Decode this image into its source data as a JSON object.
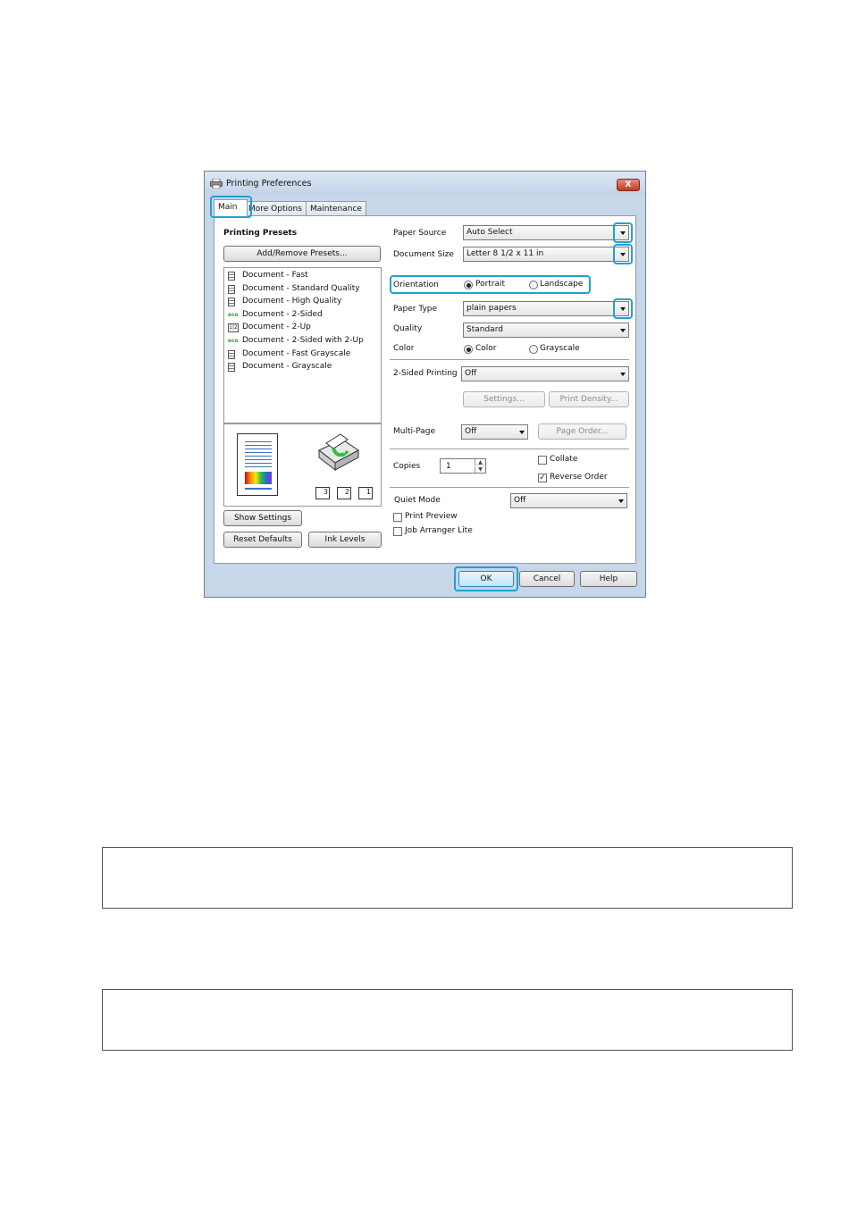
{
  "window": {
    "title": "Printing Preferences",
    "close_label": "X"
  },
  "tabs": [
    {
      "label": "Main"
    },
    {
      "label": "More Options"
    },
    {
      "label": "Maintenance"
    }
  ],
  "presets": {
    "heading": "Printing Presets",
    "add_remove_label": "Add/Remove Presets...",
    "items": [
      {
        "label": "Document - Fast",
        "icon": "document-icon"
      },
      {
        "label": "Document - Standard Quality",
        "icon": "document-icon"
      },
      {
        "label": "Document - High Quality",
        "icon": "document-icon"
      },
      {
        "label": "Document - 2-Sided",
        "icon": "eco-icon",
        "icon_text": "eco"
      },
      {
        "label": "Document - 2-Up",
        "icon": "two-up-icon",
        "icon_text": "1|2"
      },
      {
        "label": "Document - 2-Sided with 2-Up",
        "icon": "eco-icon",
        "icon_text": "eco"
      },
      {
        "label": "Document - Fast Grayscale",
        "icon": "document-icon"
      },
      {
        "label": "Document - Grayscale",
        "icon": "document-icon"
      }
    ]
  },
  "preview": {
    "page_numbers": [
      "3",
      "2",
      "1"
    ]
  },
  "left_buttons": {
    "show_settings": "Show Settings",
    "reset_defaults": "Reset Defaults",
    "ink_levels": "Ink Levels"
  },
  "settings": {
    "paper_source_label": "Paper Source",
    "paper_source_value": "Auto Select",
    "document_size_label": "Document Size",
    "document_size_value": "Letter 8 1/2 x 11 in",
    "orientation_label": "Orientation",
    "portrait_label": "Portrait",
    "landscape_label": "Landscape",
    "paper_type_label": "Paper Type",
    "paper_type_value": "plain papers",
    "quality_label": "Quality",
    "quality_value": "Standard",
    "color_label": "Color",
    "color_option_label": "Color",
    "grayscale_label": "Grayscale",
    "two_sided_label": "2-Sided Printing",
    "two_sided_value": "Off",
    "settings_btn": "Settings...",
    "print_density_btn": "Print Density...",
    "multipage_label": "Multi-Page",
    "multipage_value": "Off",
    "page_order_btn": "Page Order...",
    "copies_label": "Copies",
    "copies_value": "1",
    "collate_label": "Collate",
    "reverse_order_label": "Reverse Order",
    "quiet_mode_label": "Quiet Mode",
    "quiet_mode_value": "Off",
    "print_preview_label": "Print Preview",
    "job_arranger_label": "Job Arranger Lite"
  },
  "footer": {
    "ok": "OK",
    "cancel": "Cancel",
    "help": "Help"
  },
  "colors": {
    "highlight": "#1ea2d6",
    "window_frame": "#c7d6e8",
    "close_button": "#c33a22"
  }
}
